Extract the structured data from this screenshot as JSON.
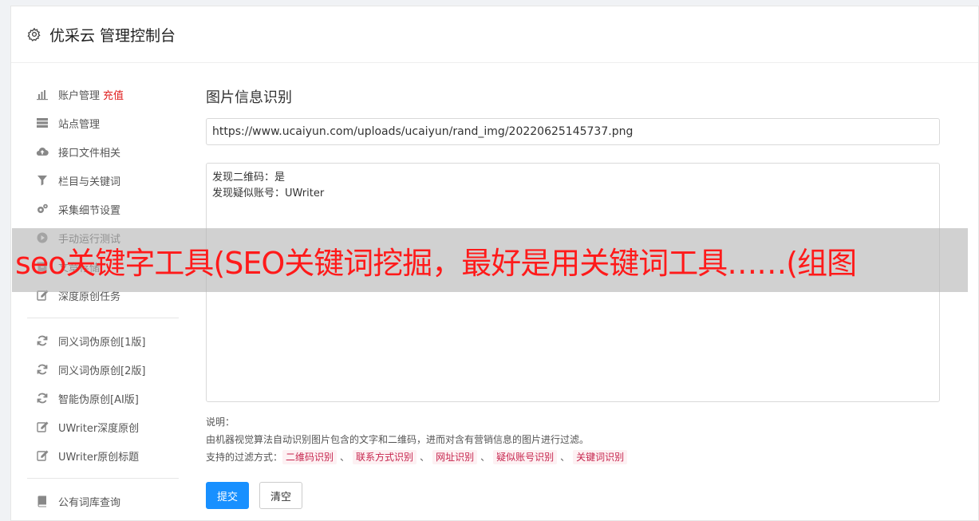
{
  "header": {
    "title": "优采云 管理控制台",
    "icon": "gear-icon"
  },
  "sidebar": {
    "group1": [
      {
        "label": "账户管理",
        "tag": "充值",
        "icon": "bar-chart-icon"
      },
      {
        "label": "站点管理",
        "icon": "server-icon"
      },
      {
        "label": "接口文件相关",
        "icon": "cloud-upload-icon"
      },
      {
        "label": "栏目与关键词",
        "icon": "filter-icon"
      },
      {
        "label": "采集细节设置",
        "icon": "gears-icon"
      },
      {
        "label": "手动运行测试",
        "icon": "play-icon"
      },
      {
        "label": "文章存储",
        "icon": "archive-icon"
      },
      {
        "label": "深度原创任务",
        "icon": "edit-icon"
      }
    ],
    "group2": [
      {
        "label": "同义词伪原创[1版]",
        "icon": "refresh-icon"
      },
      {
        "label": "同义词伪原创[2版]",
        "icon": "refresh-icon"
      },
      {
        "label": "智能伪原创[AI版]",
        "icon": "refresh-icon"
      },
      {
        "label": "UWriter深度原创",
        "icon": "edit-icon"
      },
      {
        "label": "UWriter原创标题",
        "icon": "edit-icon"
      }
    ],
    "group3": [
      {
        "label": "公有词库查询",
        "icon": "book-icon"
      }
    ]
  },
  "main": {
    "title": "图片信息识别",
    "url_value": "https://www.ucaiyun.com/uploads/ucaiyun/rand_img/20220625145737.png",
    "result_lines": [
      "发现二维码：是",
      "发现疑似账号：UWriter"
    ],
    "notes_label": "说明：",
    "notes_text": "由机器视觉算法自动识别图片包含的文字和二维码，进而对含有营销信息的图片进行过滤。",
    "filter_label": "支持的过滤方式：",
    "filters": [
      "二维码识别",
      "联系方式识别",
      "网址识别",
      "疑似账号识别",
      "关键词识别"
    ],
    "separator": "、",
    "submit_label": "提交",
    "clear_label": "清空"
  },
  "banner": {
    "text": "seo关键字工具(SEO关键词挖掘，最好是用关键词工具……(组图"
  },
  "colors": {
    "primary": "#1890ff",
    "tag": "#e02020",
    "chip_text": "#c7254e",
    "banner_text": "#ff1a1a"
  }
}
